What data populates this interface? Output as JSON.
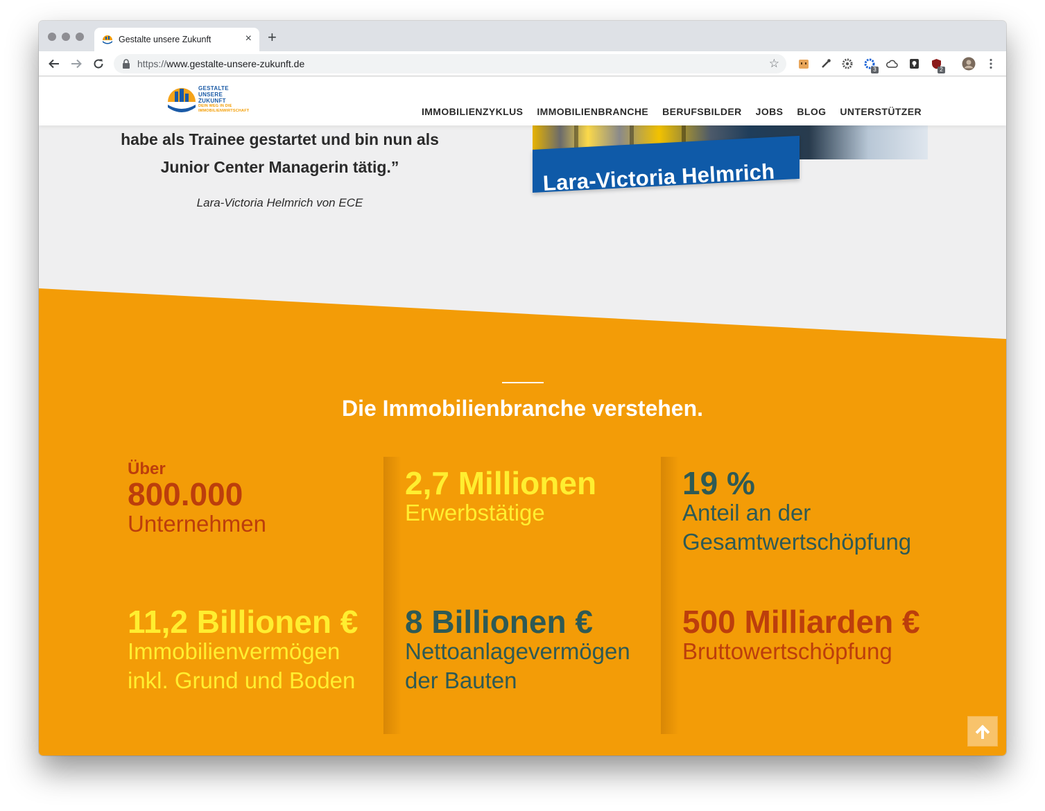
{
  "browser": {
    "tab_title": "Gestalte unsere Zukunft",
    "tab_close": "×",
    "new_tab": "+",
    "url_scheme": "https://",
    "url_host": "www.gestalte-unsere-zukunft.de",
    "extension_badges": [
      "3",
      "2"
    ]
  },
  "site": {
    "logo": {
      "line1": "GESTALTE",
      "line2": "UNSERE",
      "line3": "ZUKUNFT",
      "sub1": "DEIN WEG IN DIE",
      "sub2": "IMMOBILIENWIRTSCHAFT"
    },
    "nav": [
      "IMMOBILIENZYKLUS",
      "IMMOBILIENBRANCHE",
      "BERUFSBILDER",
      "JOBS",
      "BLOG",
      "UNTERSTÜTZER"
    ]
  },
  "testimonial": {
    "quote_line1": "habe als Trainee gestartet und bin nun als",
    "quote_line2": "Junior Center Managerin tätig.”",
    "author": "Lara-Victoria Helmrich von ECE",
    "name_banner": "Lara-Victoria Helmrich"
  },
  "facts": {
    "title": "Die Immobilienbranche verstehen.",
    "items": [
      {
        "pre": "Über",
        "value": "800.000",
        "desc": "Unternehmen",
        "color": "#bc3e0c"
      },
      {
        "pre": "",
        "value": "2,7 Millionen",
        "desc": "Erwerbstätige",
        "color": "#ffee30"
      },
      {
        "pre": "",
        "value": "19 %",
        "desc": "Anteil an der Gesamtwertschöpfung",
        "color": "#2e5a55"
      },
      {
        "pre": "",
        "value": "11,2 Billionen €",
        "desc": "Immobilienvermögen inkl. Grund und Boden",
        "color": "#ffee30"
      },
      {
        "pre": "",
        "value": "8 Billionen €",
        "desc": "Nettoanlagevermögen der Bauten",
        "color": "#2e5a55"
      },
      {
        "pre": "",
        "value": "500 Milliarden €",
        "desc": "Bruttowertschöpfung",
        "color": "#bc3e0c"
      }
    ]
  },
  "colors": {
    "orange": "#f39c07",
    "brand_blue": "#0f5aa8",
    "background": "#efeff0"
  }
}
